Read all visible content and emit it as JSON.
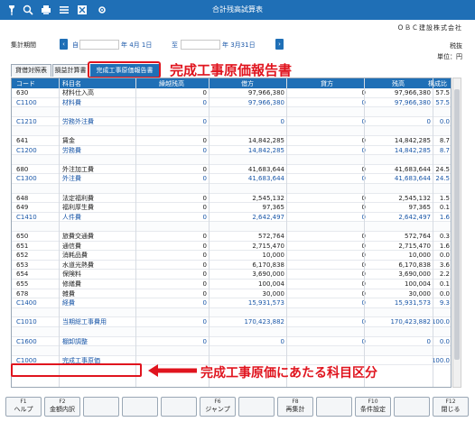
{
  "window": {
    "title": "合計残高試算表"
  },
  "header": {
    "company": "ＯＢＣ建設株式会社",
    "period_label": "集計期間",
    "from_era": "自",
    "from_date": "年  4月 1日",
    "to_era": "至",
    "to_date": "年  3月31日",
    "tax": "税抜",
    "unit": "単位：円"
  },
  "tabs": [
    {
      "label": "貸借対照表"
    },
    {
      "label": "損益計算書"
    },
    {
      "label": "完成工事原価報告書"
    }
  ],
  "annotations": {
    "tab": "完成工事原価報告書",
    "row": "完成工事原価にあたる科目区分"
  },
  "table": {
    "headers": [
      "コード",
      "科目名",
      "繰越残高",
      "借方",
      "貸方",
      "残高",
      "構成比"
    ],
    "rows": [
      {
        "type": "acct",
        "code": "630",
        "name": "材料仕入高",
        "b": "0",
        "d": "97,966,380",
        "c": "0",
        "bal": "97,966,380",
        "r": "57.5"
      },
      {
        "type": "sub",
        "code": "C1100",
        "name": "材料費",
        "b": "0",
        "d": "97,966,380",
        "c": "0",
        "bal": "97,966,380",
        "r": "57.5"
      },
      {
        "type": "blank"
      },
      {
        "type": "sub",
        "code": "C1210",
        "name": "労務外注費",
        "b": "0",
        "d": "0",
        "c": "0",
        "bal": "0",
        "r": "0.0"
      },
      {
        "type": "blank"
      },
      {
        "type": "acct",
        "code": "641",
        "name": "賃金",
        "b": "0",
        "d": "14,842,285",
        "c": "0",
        "bal": "14,842,285",
        "r": "8.7"
      },
      {
        "type": "sub",
        "code": "C1200",
        "name": "労務費",
        "b": "0",
        "d": "14,842,285",
        "c": "0",
        "bal": "14,842,285",
        "r": "8.7"
      },
      {
        "type": "blank"
      },
      {
        "type": "acct",
        "code": "680",
        "name": "外注加工費",
        "b": "0",
        "d": "41,683,644",
        "c": "0",
        "bal": "41,683,644",
        "r": "24.5"
      },
      {
        "type": "sub",
        "code": "C1300",
        "name": "外注費",
        "b": "0",
        "d": "41,683,644",
        "c": "0",
        "bal": "41,683,644",
        "r": "24.5"
      },
      {
        "type": "blank"
      },
      {
        "type": "acct",
        "code": "648",
        "name": "法定福利費",
        "b": "0",
        "d": "2,545,132",
        "c": "0",
        "bal": "2,545,132",
        "r": "1.5"
      },
      {
        "type": "acct",
        "code": "649",
        "name": "福利厚生費",
        "b": "0",
        "d": "97,365",
        "c": "0",
        "bal": "97,365",
        "r": "0.1"
      },
      {
        "type": "sub",
        "code": "C1410",
        "name": "人件費",
        "b": "0",
        "d": "2,642,497",
        "c": "0",
        "bal": "2,642,497",
        "r": "1.6"
      },
      {
        "type": "blank"
      },
      {
        "type": "acct",
        "code": "650",
        "name": "旅費交通費",
        "b": "0",
        "d": "572,764",
        "c": "0",
        "bal": "572,764",
        "r": "0.3"
      },
      {
        "type": "acct",
        "code": "651",
        "name": "通信費",
        "b": "0",
        "d": "2,715,470",
        "c": "0",
        "bal": "2,715,470",
        "r": "1.6"
      },
      {
        "type": "acct",
        "code": "652",
        "name": "消耗品費",
        "b": "0",
        "d": "10,000",
        "c": "0",
        "bal": "10,000",
        "r": "0.0"
      },
      {
        "type": "acct",
        "code": "653",
        "name": "水道光熱費",
        "b": "0",
        "d": "6,170,838",
        "c": "0",
        "bal": "6,170,838",
        "r": "3.6"
      },
      {
        "type": "acct",
        "code": "654",
        "name": "保険料",
        "b": "0",
        "d": "3,690,000",
        "c": "0",
        "bal": "3,690,000",
        "r": "2.2"
      },
      {
        "type": "acct",
        "code": "655",
        "name": "修繕費",
        "b": "0",
        "d": "100,004",
        "c": "0",
        "bal": "100,004",
        "r": "0.1"
      },
      {
        "type": "acct",
        "code": "678",
        "name": "雑費",
        "b": "0",
        "d": "30,000",
        "c": "0",
        "bal": "30,000",
        "r": "0.0"
      },
      {
        "type": "sub",
        "code": "C1400",
        "name": "経費",
        "b": "0",
        "d": "15,931,573",
        "c": "0",
        "bal": "15,931,573",
        "r": "9.3"
      },
      {
        "type": "blank"
      },
      {
        "type": "sub",
        "code": "C1010",
        "name": "当期総工事費用",
        "b": "0",
        "d": "170,423,882",
        "c": "0",
        "bal": "170,423,882",
        "r": "100.0"
      },
      {
        "type": "blank"
      },
      {
        "type": "sub",
        "code": "C1600",
        "name": "棚卸調整",
        "b": "0",
        "d": "0",
        "c": "0",
        "bal": "0",
        "r": "0.0"
      },
      {
        "type": "blank"
      },
      {
        "type": "sub",
        "code": "C1000",
        "name": "完成工事原価",
        "b": "",
        "d": "",
        "c": "",
        "bal": "",
        "r": "100.0"
      }
    ]
  },
  "fkeys": [
    {
      "num": "F1",
      "label": "ヘルプ"
    },
    {
      "num": "F2",
      "label": "金額内訳"
    },
    {
      "num": "",
      "label": ""
    },
    {
      "num": "",
      "label": ""
    },
    {
      "num": "",
      "label": ""
    },
    {
      "num": "F6",
      "label": "ジャンプ"
    },
    {
      "num": "",
      "label": ""
    },
    {
      "num": "F8",
      "label": "再集計"
    },
    {
      "num": "",
      "label": ""
    },
    {
      "num": "F10",
      "label": "条件設定"
    },
    {
      "num": "",
      "label": ""
    },
    {
      "num": "F12",
      "label": "閉じる"
    }
  ]
}
